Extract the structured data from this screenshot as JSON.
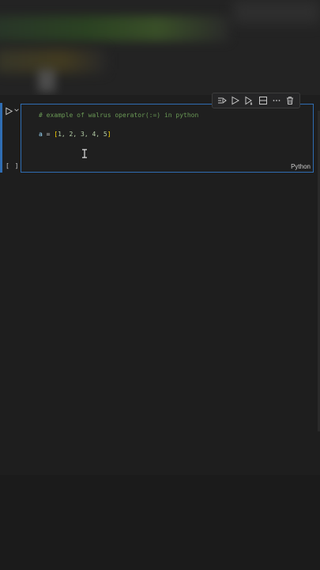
{
  "toolbar": {
    "items": [
      {
        "icon": "execute-above-icon"
      },
      {
        "icon": "run-icon"
      },
      {
        "icon": "run-below-icon"
      },
      {
        "icon": "split-cell-icon"
      },
      {
        "icon": "more-icon",
        "label": "···"
      },
      {
        "icon": "trash-icon"
      }
    ]
  },
  "cell": {
    "comment": "# example of walrus operator(:=) in python",
    "code": {
      "var": "a",
      "op": " = ",
      "open": "[",
      "items": "1, 2, 3, 4, 5",
      "close": "]"
    },
    "language": "Python",
    "exec_count": "[ ]"
  },
  "colors": {
    "accent": "#2f6db3",
    "comment": "#6a9955",
    "variable": "#9cdcfe",
    "bracket": "#ffd700",
    "number": "#b5cea8",
    "background": "#1e1e1e"
  }
}
